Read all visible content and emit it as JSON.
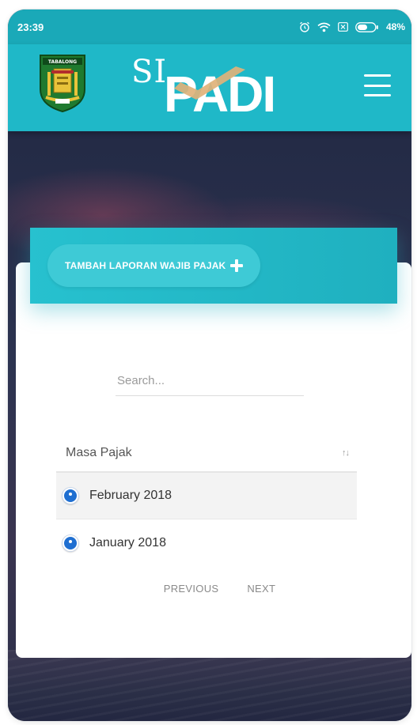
{
  "status_bar": {
    "time": "23:39",
    "battery": "48%",
    "icons": [
      "alarm-icon",
      "wifi-icon",
      "sim-x-icon",
      "battery-icon"
    ]
  },
  "header": {
    "crest_label": "TABALONG",
    "logo_prefix": "SI",
    "logo_main": "PADI",
    "menu_icon": "hamburger-menu-icon"
  },
  "actions": {
    "add_report_label": "TAMBAH LAPORAN WAJIB PAJAK"
  },
  "search": {
    "placeholder": "Search...",
    "value": ""
  },
  "table": {
    "column_header": "Masa Pajak",
    "rows": [
      {
        "label": "February 2018"
      },
      {
        "label": "January 2018"
      }
    ]
  },
  "pagination": {
    "previous_label": "PREVIOUS",
    "next_label": "NEXT"
  },
  "colors": {
    "teal_header": "#1fb8c8",
    "teal_banner": "#27c1cf",
    "expand_blue": "#1f6fd1",
    "logo_check": "#e0b27a"
  }
}
